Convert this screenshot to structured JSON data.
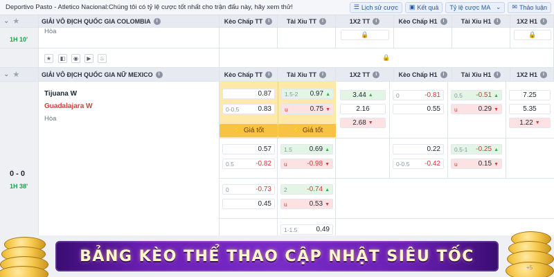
{
  "topbar": {
    "notice": "Deportivo Pasto - Atletico Nacional:Chúng tôi có tỷ lệ cược tốt nhất cho trận đấu này, hãy xem thử!",
    "history_btn": "Lịch sử cược",
    "results_btn": "Kết quả",
    "odds_type_btn": "Tỷ lệ cược MA",
    "discuss_btn": "Thảo luận"
  },
  "colombia": {
    "league": "GIẢI VÔ ĐỊCH QUỐC GIA COLOMBIA",
    "headers": [
      "Kèo Chấp TT",
      "Tài Xỉu TT",
      "1X2 TT",
      "Kèo Chấp H1",
      "Tài Xỉu H1",
      "1X2 H1"
    ],
    "time": "1H 10'",
    "draw": "Hòa"
  },
  "mexico": {
    "league": "GIẢI VÔ ĐỊCH QUỐC GIA NỮ MEXICO",
    "headers": [
      "Kèo Chấp TT",
      "Tài Xỉu TT",
      "1X2 TT",
      "Kèo Chấp H1",
      "Tài Xỉu H1",
      "1X2 H1"
    ],
    "home": "Tijuana W",
    "away": "Guadalajara W",
    "draw": "Hòa",
    "score": "0 - 0",
    "time": "1H 38'",
    "hot_label": "Giá tốt",
    "block1": {
      "hc_tt": [
        {
          "line": "",
          "val": "0.87"
        },
        {
          "line": "0-0.5",
          "val": "0.83"
        }
      ],
      "ou_tt": [
        {
          "line": "1.5-2",
          "val": "0.97"
        },
        {
          "line": "u",
          "val": "0.75"
        }
      ],
      "x12_tt": [
        "3.44",
        "2.16",
        "2.68"
      ],
      "hc_h1": [
        {
          "line": "0",
          "val": "-0.81"
        },
        {
          "line": "",
          "val": "0.55"
        }
      ],
      "ou_h1": [
        {
          "line": "0.5",
          "val": "-0.51"
        },
        {
          "line": "u",
          "val": "0.29"
        }
      ],
      "x12_h1": [
        "7.25",
        "5.35",
        "1.22"
      ]
    },
    "block2": {
      "hc_tt": [
        {
          "line": "",
          "val": "0.57"
        },
        {
          "line": "0.5",
          "val": "-0.82"
        }
      ],
      "ou_tt": [
        {
          "line": "1.5",
          "val": "0.69"
        },
        {
          "line": "u",
          "val": "-0.98"
        }
      ],
      "hc_h1": [
        {
          "line": "",
          "val": "0.22"
        },
        {
          "line": "0-0.5",
          "val": "-0.42"
        }
      ],
      "ou_h1": [
        {
          "line": "0.5-1",
          "val": "-0.25"
        },
        {
          "line": "u",
          "val": "0.15"
        }
      ]
    },
    "block3": {
      "hc_tt": [
        {
          "line": "0",
          "val": "-0.73"
        },
        {
          "line": "",
          "val": "0.45"
        }
      ],
      "ou_tt": [
        {
          "line": "2",
          "val": "-0.74"
        },
        {
          "line": "u",
          "val": "0.53"
        }
      ]
    },
    "block4": {
      "ou_tt": [
        {
          "line": "1-1.5",
          "val": "0.49"
        }
      ]
    }
  },
  "banner": {
    "text": "BẢNG KÈO THỂ THAO CẬP NHẬT SIÊU TỐC",
    "corner": "+5"
  }
}
